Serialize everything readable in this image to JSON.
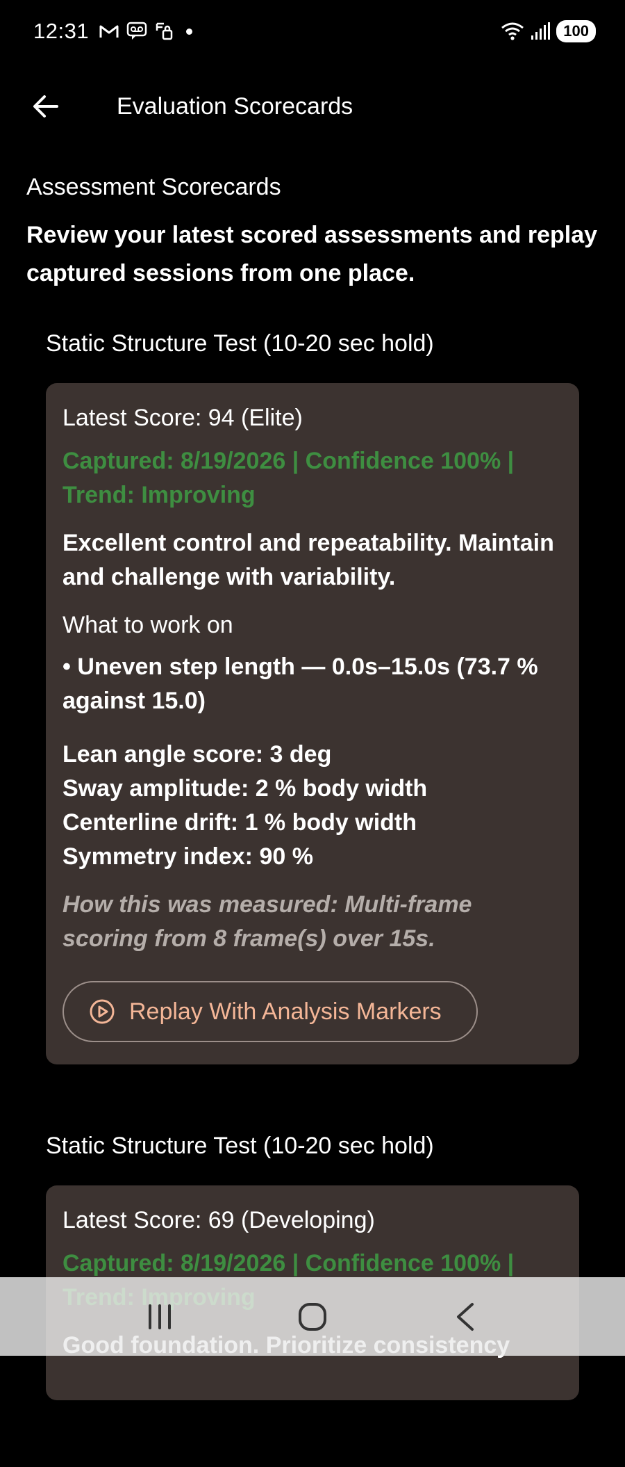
{
  "status_bar": {
    "time": "12:31",
    "battery": "100",
    "icons": [
      "gmail-icon",
      "voicemail-icon",
      "lock-icon",
      "dot-icon",
      "wifi-icon",
      "signal-icon",
      "battery-icon"
    ]
  },
  "app_bar": {
    "title": "Evaluation Scorecards",
    "back_icon": "arrow-left-icon"
  },
  "section": {
    "heading": "Assessment Scorecards",
    "intro": "Review your latest scored assessments and replay captured sessions from one place."
  },
  "tests": [
    {
      "title": "Static Structure Test (10-20 sec hold)",
      "latest_score": "Latest Score: 94 (Elite)",
      "captured": "Captured: 8/19/2026 | Confidence 100% | Trend: Improving",
      "summary": "Excellent control and repeatability. Maintain and challenge with variability.",
      "work_heading": "What to work on",
      "work_item": "• Uneven step length — 0.0s–15.0s (73.7 % against 15.0)",
      "metrics": [
        "Lean angle score: 3 deg",
        "Sway amplitude: 2 % body width",
        "Centerline drift: 1 % body width",
        "Symmetry index: 90 %"
      ],
      "measured": "How this was measured: Multi-frame scoring from 8 frame(s) over 15s.",
      "replay_label": "Replay With Analysis Markers"
    },
    {
      "title": "Static Structure Test (10-20 sec hold)",
      "latest_score": "Latest Score: 69 (Developing)",
      "captured": "Captured: 8/19/2026 | Confidence 100% | Trend: Improving",
      "summary": "Good foundation. Prioritize consistency"
    }
  ],
  "colors": {
    "background": "#000000",
    "card": "#3c3330",
    "captured_green": "#3e8e41",
    "accent": "#f4b697",
    "muted_italic": "#b5aeaa"
  },
  "nav_bar": {
    "icons": [
      "recent-apps-icon",
      "home-icon",
      "back-icon"
    ]
  }
}
